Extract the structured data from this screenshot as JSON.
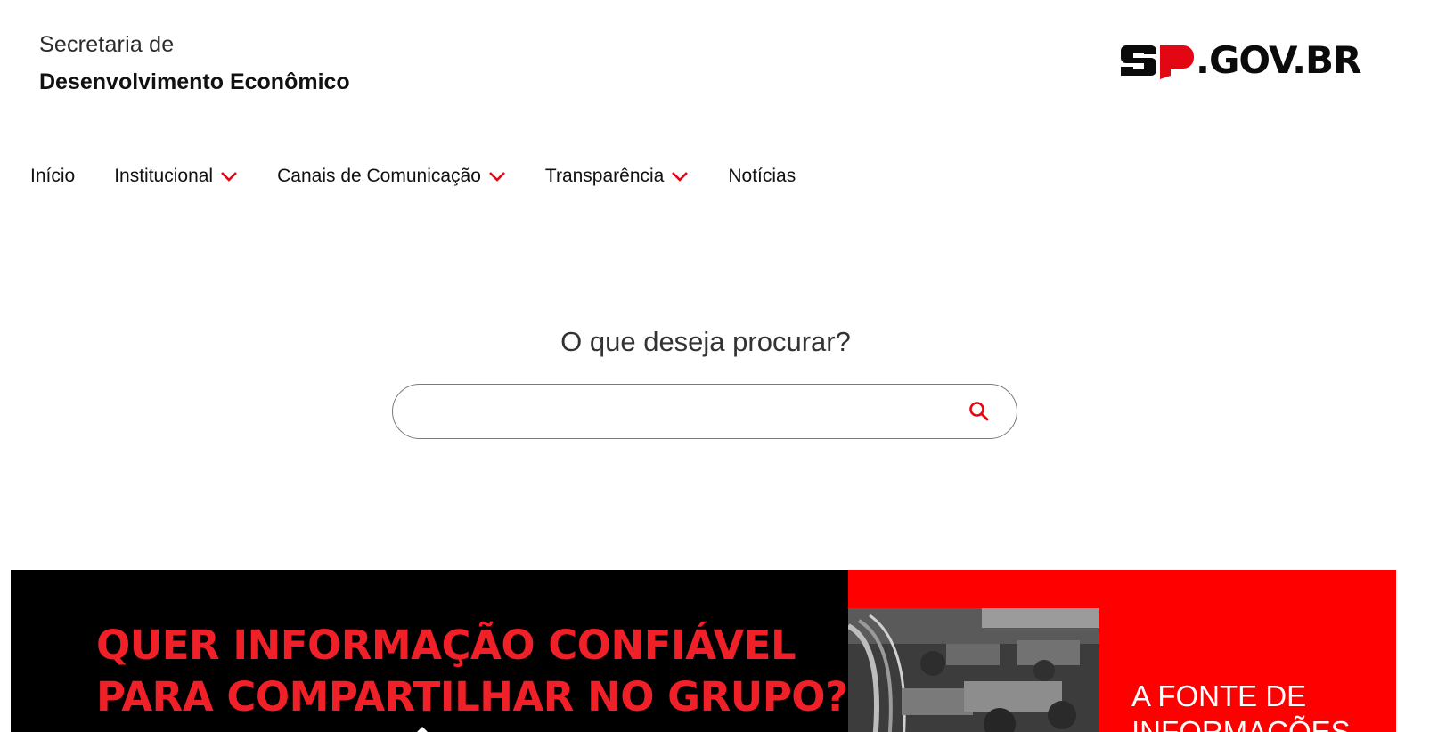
{
  "header": {
    "org_line1": "Secretaria de",
    "org_line2": "Desenvolvimento Econômico",
    "logo_text": ".GOV.BR",
    "logo_mark_text": "SP"
  },
  "nav": {
    "items": [
      {
        "label": "Início",
        "has_dropdown": false
      },
      {
        "label": "Institucional",
        "has_dropdown": true
      },
      {
        "label": "Canais de Comunicação",
        "has_dropdown": true
      },
      {
        "label": "Transparência",
        "has_dropdown": true
      },
      {
        "label": "Notícias",
        "has_dropdown": false
      }
    ]
  },
  "search": {
    "title": "O que deseja procurar?",
    "value": "",
    "placeholder": "",
    "icon": "search-icon"
  },
  "banner": {
    "headline_line1": "QUER INFORMAÇÃO CONFIÁVEL",
    "headline_line2": "PARA COMPARTILHAR NO GRUPO?",
    "right_line1": "A FONTE DE",
    "right_line2": "INFORMAÇÕES"
  },
  "colors": {
    "accent": "#e30613",
    "banner_red": "#ff0000",
    "banner_black": "#000000",
    "headline_red": "#ef2028"
  }
}
